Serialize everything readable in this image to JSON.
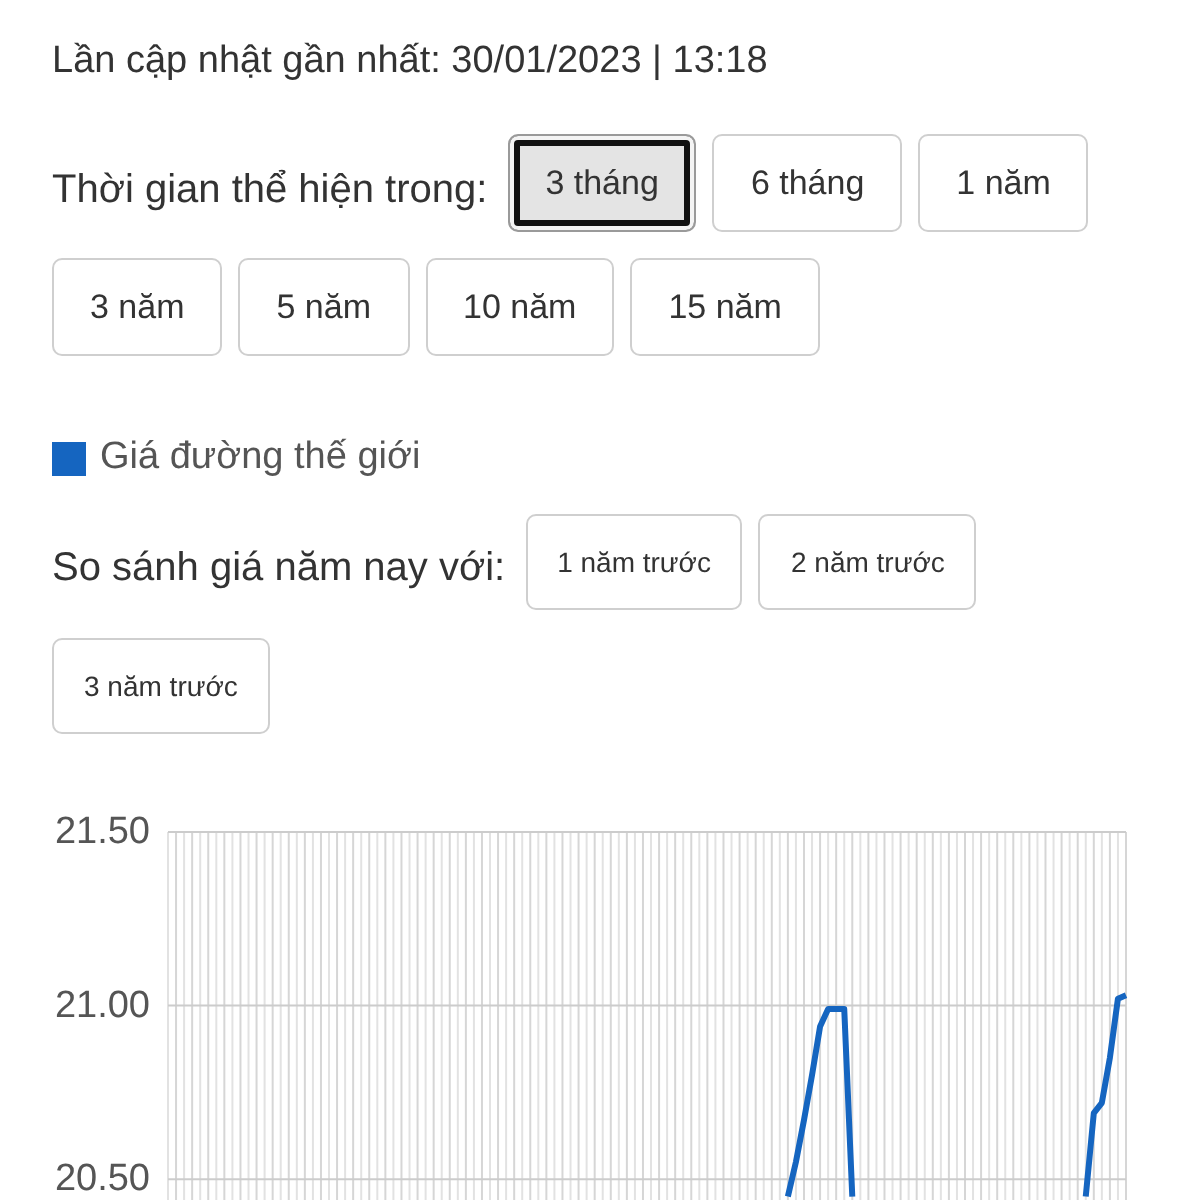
{
  "last_updated": "Lần cập nhật gần nhất: 30/01/2023 | 13:18",
  "time_range": {
    "label": "Thời gian thể hiện trong:",
    "options": [
      {
        "label": "3 tháng",
        "selected": true
      },
      {
        "label": "6 tháng",
        "selected": false
      },
      {
        "label": "1 năm",
        "selected": false
      },
      {
        "label": "3 năm",
        "selected": false
      },
      {
        "label": "5 năm",
        "selected": false
      },
      {
        "label": "10 năm",
        "selected": false
      },
      {
        "label": "15 năm",
        "selected": false
      }
    ]
  },
  "compare": {
    "label": "So sánh giá năm nay với:",
    "options": [
      {
        "label": "1 năm trước",
        "selected": false
      },
      {
        "label": "2 năm trước",
        "selected": false
      },
      {
        "label": "3 năm trước",
        "selected": false
      }
    ]
  },
  "chart": {
    "chart_data": {
      "type": "line",
      "grid": true,
      "ylim": [
        20.44,
        21.5
      ],
      "yticks": [
        {
          "value": 21.5,
          "label": "21.50"
        },
        {
          "value": 21,
          "label": "21.00"
        },
        {
          "value": 20.5,
          "label": "20.50"
        }
      ],
      "series": [
        {
          "name": "Giá đường thế giới",
          "color": "#1565c0",
          "values": [
            null,
            null,
            null,
            null,
            null,
            null,
            null,
            null,
            null,
            null,
            null,
            null,
            null,
            null,
            null,
            null,
            null,
            null,
            null,
            null,
            null,
            null,
            null,
            null,
            null,
            null,
            null,
            null,
            null,
            null,
            null,
            null,
            null,
            null,
            null,
            null,
            null,
            null,
            null,
            null,
            null,
            null,
            null,
            null,
            null,
            null,
            null,
            null,
            null,
            null,
            null,
            null,
            null,
            null,
            null,
            null,
            null,
            null,
            null,
            null,
            null,
            null,
            null,
            null,
            null,
            null,
            null,
            null,
            null,
            null,
            null,
            null,
            null,
            null,
            null,
            null,
            null,
            20.45,
            20.55,
            20.67,
            20.8,
            20.94,
            20.99,
            20.99,
            20.99,
            20.45,
            null,
            null,
            null,
            null,
            null,
            null,
            null,
            null,
            null,
            null,
            null,
            null,
            null,
            null,
            null,
            null,
            null,
            null,
            null,
            null,
            null,
            null,
            null,
            null,
            null,
            null,
            null,
            null,
            20.45,
            20.69,
            20.72,
            20.85,
            21.02,
            21.03
          ]
        }
      ]
    }
  }
}
